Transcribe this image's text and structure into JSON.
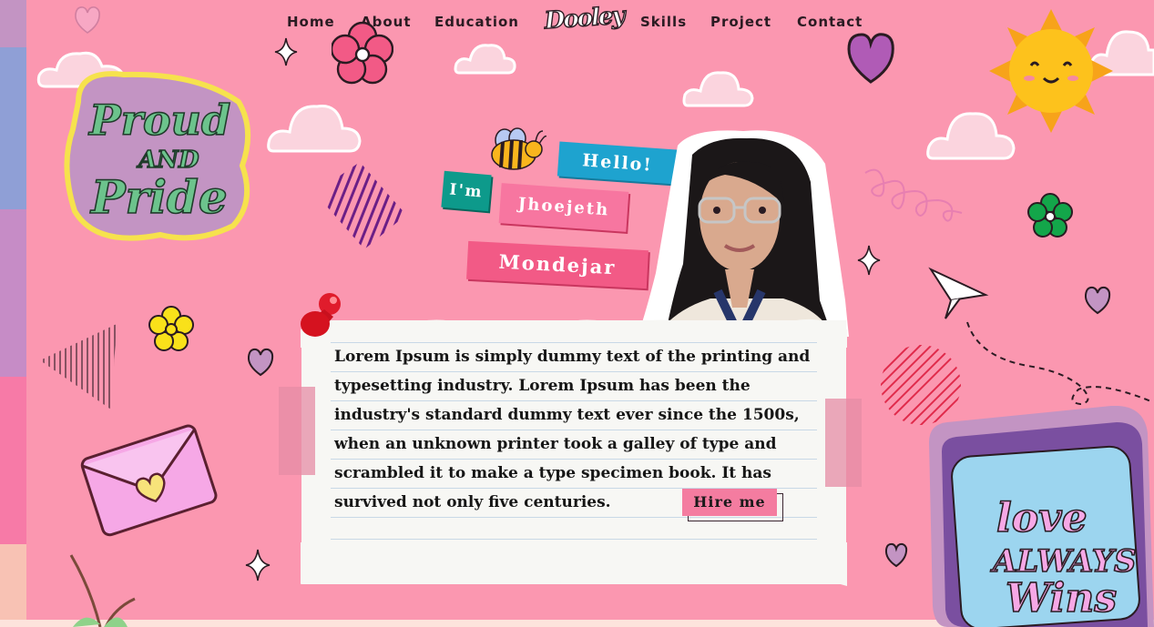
{
  "nav": {
    "links": [
      "Home",
      "About",
      "Education",
      "Skills",
      "Project",
      "Contact"
    ],
    "logo_text": "Dooley"
  },
  "hero": {
    "tags": [
      "Hello!",
      "I'm",
      "Jhoejeth",
      "Mondejar"
    ]
  },
  "stickers": {
    "left_badge_lines": [
      "Proud",
      "AND",
      "Pride"
    ],
    "right_badge_lines": [
      "love",
      "ALWAYS",
      "Wins"
    ]
  },
  "about": {
    "paragraph": "Lorem Ipsum is simply dummy text of the printing and typesetting industry. Lorem Ipsum has been the industry's standard dummy text ever since the 1500s, when an unknown printer took a galley of type and scrambled it to make a type specimen book. It has survived not only five centuries.",
    "hire_label": "Hire me"
  },
  "colors": {
    "background": "#fb97b0",
    "accent_pink": "#f25a86",
    "accent_blue": "#1ea3cf",
    "accent_teal": "#0d9a8b",
    "ink": "#2a1b22"
  },
  "icons": [
    "bee-icon",
    "sun-icon",
    "flower-icon",
    "heart-icon",
    "sparkle-icon",
    "paper-plane-icon",
    "envelope-icon",
    "pushpin-icon"
  ]
}
